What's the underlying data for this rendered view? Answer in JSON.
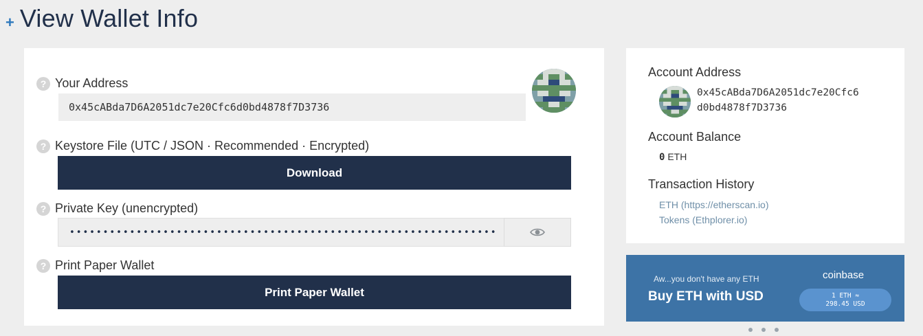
{
  "header": {
    "expand_symbol": "+",
    "title": "View Wallet Info"
  },
  "wallet": {
    "address_label": "Your Address",
    "address": "0x45cABda7D6A2051dc7e20Cfc6d0bd4878f7D3736",
    "keystore_label": "Keystore File (UTC / JSON · Recommended · Encrypted)",
    "download_label": "Download",
    "private_key_label": "Private Key (unencrypted)",
    "private_key_masked": "••••••••••••••••••••••••••••••••••••••••••••••••••••••••••••••••",
    "print_label": "Print Paper Wallet",
    "print_button_label": "Print Paper Wallet",
    "help_symbol": "?"
  },
  "account": {
    "address_heading": "Account Address",
    "address_line1": "0x45cABda7D6A2051dc7e20Cfc6",
    "address_line2": "d0bd4878f7D3736",
    "balance_heading": "Account Balance",
    "balance_value": "0",
    "balance_unit": "ETH",
    "history_heading": "Transaction History",
    "history_links": [
      {
        "label": "ETH (https://etherscan.io)"
      },
      {
        "label": "Tokens (Ethplorer.io)"
      }
    ]
  },
  "coinbase": {
    "subtitle": "Aw...you don't have any ETH",
    "title": "Buy ETH with USD",
    "brand": "coinbase",
    "rate_line1": "1 ETH ≈",
    "rate_line2": "298.45 USD"
  },
  "icons": {
    "help": "help-icon",
    "eye": "eye-icon",
    "identicon": "identicon",
    "plus": "plus-icon"
  },
  "colors": {
    "navy": "#21304a",
    "accent_blue": "#2f79bd",
    "banner_blue": "#3d73a6",
    "link": "#6f8fa8",
    "background": "#eeeeee"
  }
}
